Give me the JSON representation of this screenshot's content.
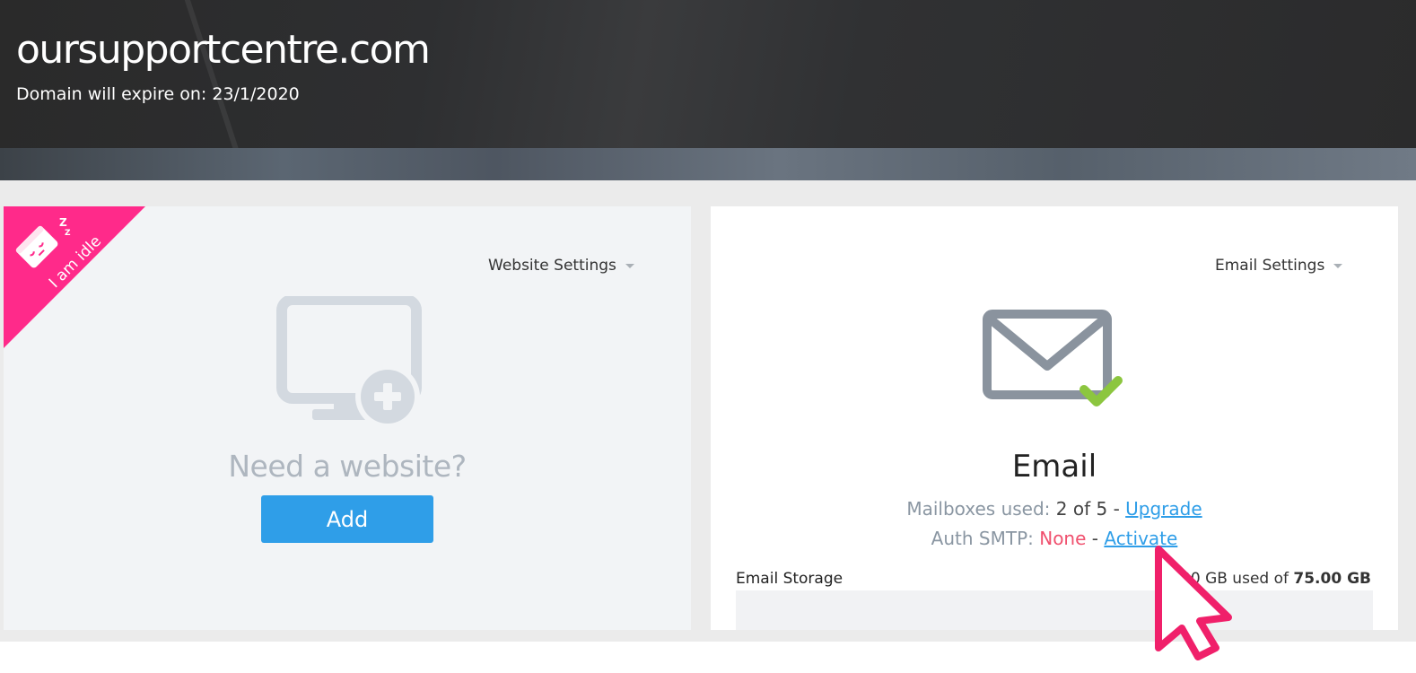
{
  "header": {
    "domain": "oursupportcentre.com",
    "expiry": "Domain will expire on: 23/1/2020"
  },
  "website_card": {
    "ribbon_text": "I am idle",
    "settings_label": "Website Settings",
    "prompt": "Need a website?",
    "add_label": "Add"
  },
  "email_card": {
    "settings_label": "Email Settings",
    "heading": "Email",
    "mailboxes_label": "Mailboxes used: ",
    "mailboxes_value": "2 of 5",
    "separator": " - ",
    "upgrade_label": "Upgrade",
    "smtp_label": "Auth SMTP: ",
    "smtp_value": "None",
    "activate_label": "Activate",
    "storage_label": "Email Storage",
    "storage_used_text": "00 GB used of ",
    "storage_total": "75.00 GB",
    "storage_fraction": 0.0
  },
  "colors": {
    "ribbon": "#ff2a8a",
    "button": "#2f9ee8",
    "link": "#2f9ee8",
    "none_status": "#f0506e",
    "check": "#8cc63f",
    "cursor": "#f0206a"
  },
  "icons": {
    "ribbon_icon": "sleeping-browser-icon",
    "website_icon": "monitor-add-icon",
    "email_icon": "envelope-check-icon",
    "dropdown_icon": "caret-down-icon",
    "pointer": "mouse-cursor-icon"
  }
}
